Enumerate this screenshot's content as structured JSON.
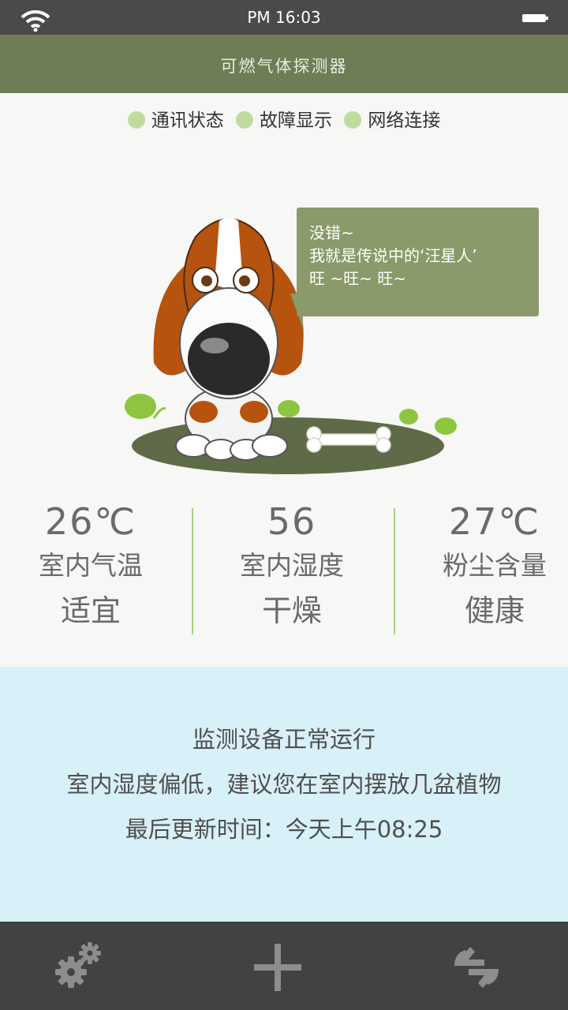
{
  "status_bar": {
    "time": "PM 16:03"
  },
  "header": {
    "title": "可燃气体探测器"
  },
  "indicators": [
    {
      "label": "通讯状态"
    },
    {
      "label": "故障显示"
    },
    {
      "label": "网络连接"
    }
  ],
  "mascot": {
    "bubble_lines": [
      "没错~",
      "我就是传说中的‘汪星人’",
      "旺 ~旺~ 旺~"
    ]
  },
  "stats": [
    {
      "value": "26℃",
      "label": "室内气温",
      "status": "适宜"
    },
    {
      "value": "56",
      "label": "室内湿度",
      "status": "干燥"
    },
    {
      "value": "27℃",
      "label": "粉尘含量",
      "status": "健康"
    }
  ],
  "info": {
    "status": "监测设备正常运行",
    "advice": "室内湿度偏低，建议您在室内摆放几盆植物",
    "updated": "最后更新时间：今天上午08:25"
  },
  "colors": {
    "header": "#6e7d55",
    "indicator": "#bfdc9e",
    "divider": "#a8cd86",
    "info_bg": "#d8f0f8",
    "bottom_bar": "#424242"
  },
  "toolbar": {
    "icons": [
      "gear-icon",
      "plus-icon",
      "refresh-icon"
    ]
  }
}
